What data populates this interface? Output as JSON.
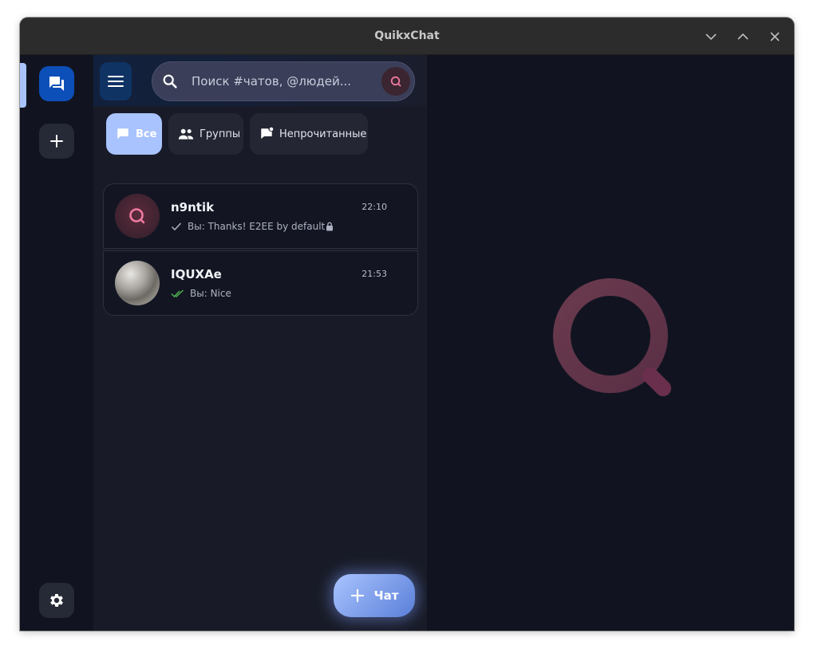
{
  "window": {
    "title": "QuikxChat"
  },
  "rail": {
    "icons": [
      "chat-bubbles-icon",
      "plus-icon",
      "gear-icon"
    ]
  },
  "search": {
    "placeholder": "Поиск #чатов, @людей..."
  },
  "filters": [
    {
      "label": "Все",
      "icon": "chat-bubble-icon",
      "active": true
    },
    {
      "label": "Группы",
      "icon": "people-icon",
      "active": false
    },
    {
      "label": "Непрочитанные",
      "icon": "unread-chat-icon",
      "active": false
    }
  ],
  "chats": [
    {
      "name": "n9ntik",
      "time": "22:10",
      "preview": "Вы: Thanks! E2EE by default",
      "status": "sent"
    },
    {
      "name": "IQUXAe",
      "time": "21:53",
      "preview": "Вы: Nice",
      "status": "read"
    }
  ],
  "fab": {
    "label": "Чат"
  },
  "colors": {
    "accent": "#a9c3ff",
    "brand_pink": "#f07aa0",
    "read_check": "#4caf50",
    "background": "#111420"
  }
}
